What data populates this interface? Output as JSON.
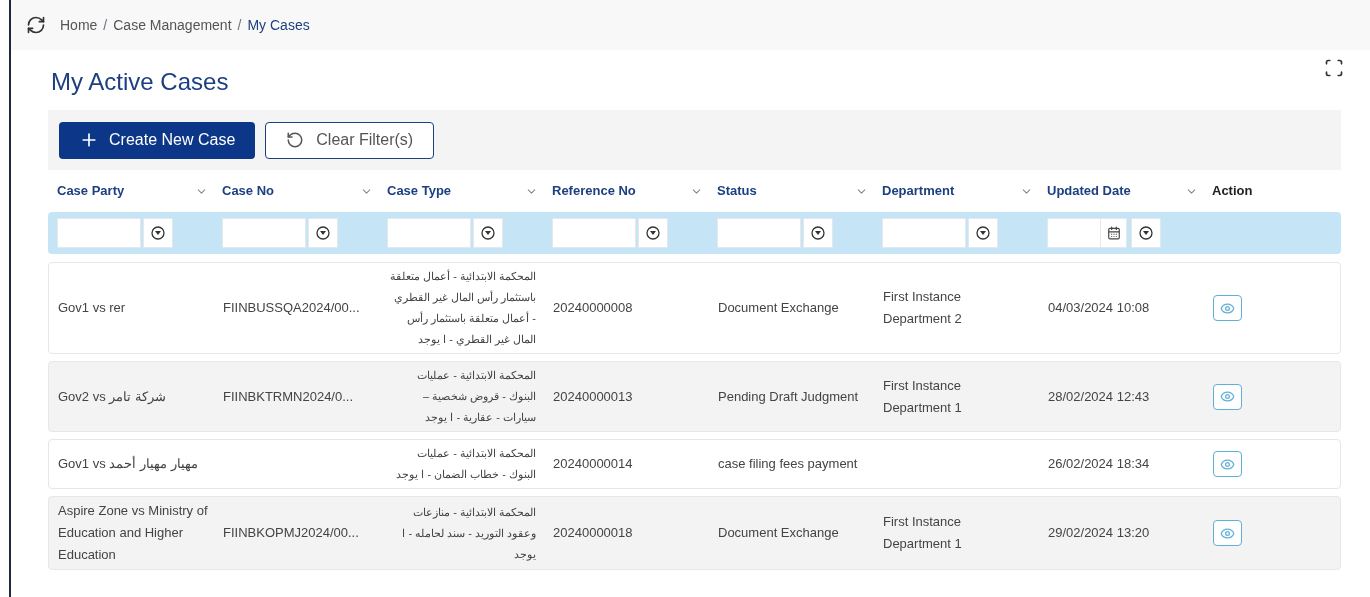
{
  "breadcrumb": [
    {
      "label": "Home",
      "selected": false
    },
    {
      "separator": "/",
      "label": "Case Management",
      "selected": false
    },
    {
      "separator": "/",
      "label": "My Cases",
      "selected": true
    }
  ],
  "title": "My Active Cases",
  "toolbar": {
    "create_button": "Create New Case",
    "clear_button": "Clear Filter(s)"
  },
  "table": {
    "columns": [
      {
        "label": "Case Party",
        "kind": "text"
      },
      {
        "label": "Case No",
        "kind": "text"
      },
      {
        "label": "Case Type",
        "kind": "text"
      },
      {
        "label": "Reference No",
        "kind": "text"
      },
      {
        "label": "Status",
        "kind": "text"
      },
      {
        "label": "Department",
        "kind": "text"
      },
      {
        "label": "Updated Date",
        "kind": "date"
      },
      {
        "label": "Action",
        "kind": "action"
      }
    ],
    "rows": [
      {
        "case_party": "Gov1 vs rer",
        "case_no": "FIINBUSSQA2024/00...",
        "case_type": "المحكمة الابتدائية - أعمال متعلقة باستثمار رأس المال غير القطري - أعمال متعلقة باستثمار رأس المال غير القطري - ا يوجد",
        "reference_no": "20240000008",
        "status": "Document Exchange",
        "department": "First Instance Department 2",
        "updated_date": "04/03/2024 10:08"
      },
      {
        "case_party": "Gov2 vs شركة تامر",
        "case_no": "FIINBKTRMN2024/0...",
        "case_type": "المحكمة الابتدائية - عمليات البنوك - قروض شخصية – سيارات - عقارية - ا يوجد",
        "reference_no": "20240000013",
        "status": "Pending Draft Judgment",
        "department": "First Instance Department 1",
        "updated_date": "28/02/2024 12:43"
      },
      {
        "case_party": "Gov1 vs مهيار مهيار أحمد",
        "case_type": "المحكمة الابتدائية - عمليات البنوك - خطاب الضمان - ا يوجد",
        "reference_no": "20240000014",
        "status": "case filing fees payment",
        "updated_date": "26/02/2024 18:34"
      },
      {
        "case_party": "Aspire Zone vs Ministry of Education and Higher Education",
        "case_no": "FIINBKOPMJ2024/00...",
        "case_type": "المحكمة الابتدائية - منازعات وعقود التوريد - سند لحامله - ا يوجد",
        "reference_no": "20240000018",
        "status": "Document Exchange",
        "department": "First Instance Department 1",
        "updated_date": "29/02/2024 13:20"
      }
    ]
  }
}
